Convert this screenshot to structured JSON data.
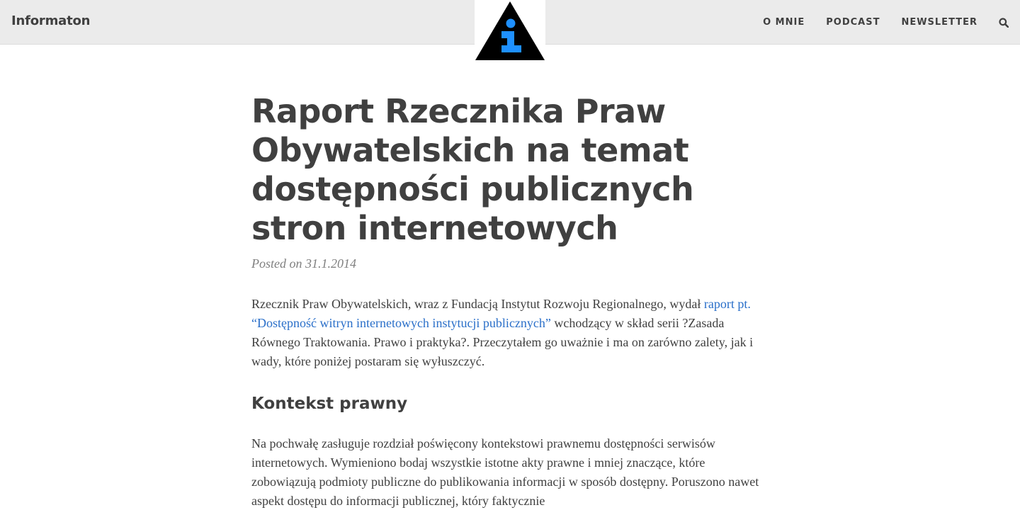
{
  "navbar": {
    "brand": "Informaton",
    "logo_icon": "info-triangle-logo",
    "links": [
      "O MNIE",
      "PODCAST",
      "NEWSLETTER"
    ],
    "search_icon": "search-icon"
  },
  "post": {
    "title": "Raport Rzecznika Praw Obywatelskich na temat dostępności publicznych stron internetowych",
    "meta": "Posted on 31.1.2014",
    "p1_before": "Rzecznik Praw Obywatelskich, wraz z Fundacją Instytut Rozwoju Regionalnego, wydał ",
    "p1_link": "raport pt. “Dostępność witryn internetowych instytucji publicznych”",
    "p1_after": " wchodzący w skład serii ?Zasada Równego Traktowania. Prawo i praktyka?. Przeczytałem go uważnie i ma on zarówno zalety, jak i wady, które poniżej postaram się wyłuszczyć.",
    "section_heading": "Kontekst prawny",
    "p2": "Na pochwałę zasługuje rozdział poświęcony kontekstowi prawnemu dostępności serwisów internetowych. Wymieniono bodaj wszystkie istotne akty prawne i mniej znaczące, które zobowiązują podmioty publiczne do publikowania informacji w sposób dostępny. Poruszono nawet aspekt dostępu do informacji publicznej, który faktycznie"
  },
  "colors": {
    "navbar_bg": "#ebebeb",
    "text": "#404040",
    "meta": "#808080",
    "link": "#2a6fc9",
    "logo_accent": "#1e90ff"
  }
}
